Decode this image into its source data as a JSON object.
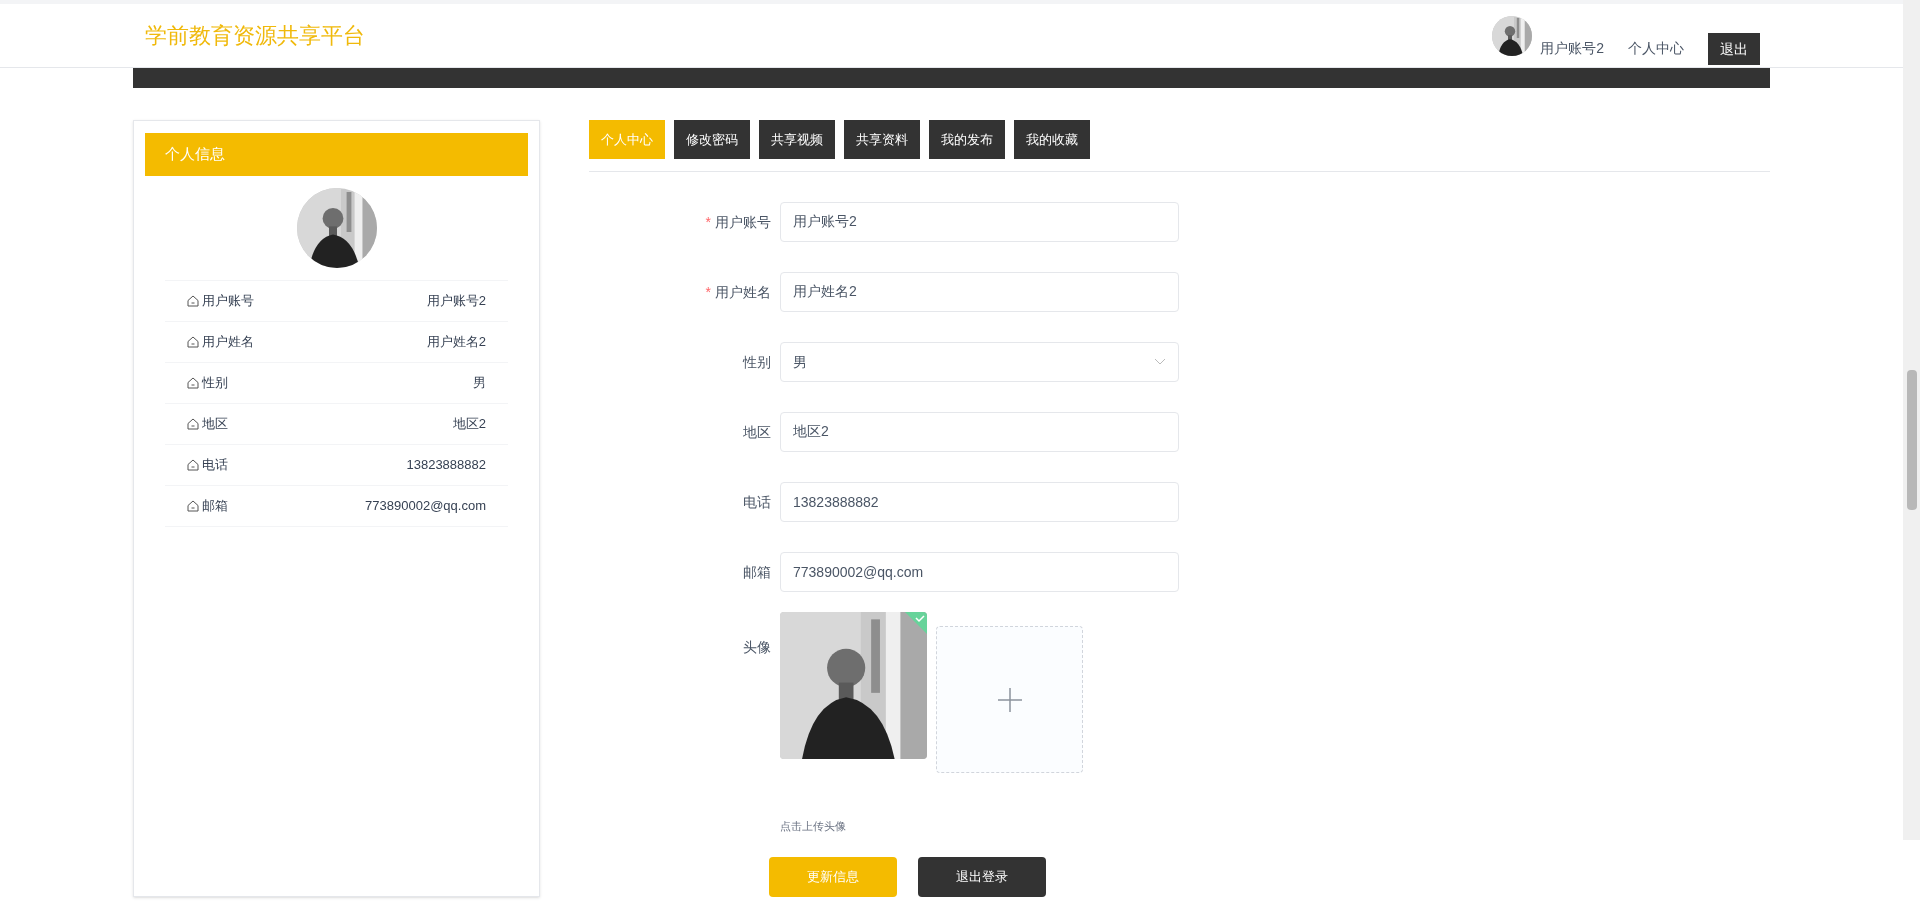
{
  "header": {
    "site_title": "学前教育资源共享平台",
    "user_name": "用户账号2",
    "nav_link": "个人中心",
    "logout_button": "退出"
  },
  "sidebar": {
    "title": "个人信息",
    "rows": [
      {
        "label": "用户账号",
        "value": "用户账号2"
      },
      {
        "label": "用户姓名",
        "value": "用户姓名2"
      },
      {
        "label": "性别",
        "value": "男"
      },
      {
        "label": "地区",
        "value": "地区2"
      },
      {
        "label": "电话",
        "value": "13823888882"
      },
      {
        "label": "邮箱",
        "value": "773890002@qq.com"
      }
    ]
  },
  "tabs": [
    {
      "label": "个人中心",
      "selected": true
    },
    {
      "label": "修改密码",
      "selected": false
    },
    {
      "label": "共享视频",
      "selected": false
    },
    {
      "label": "共享资料",
      "selected": false
    },
    {
      "label": "我的发布",
      "selected": false
    },
    {
      "label": "我的收藏",
      "selected": false
    }
  ],
  "form": {
    "fields": [
      {
        "kind": "text",
        "required_mark": "*",
        "label": "用户账号",
        "value": "用户账号2"
      },
      {
        "kind": "text",
        "required_mark": "*",
        "label": "用户姓名",
        "value": "用户姓名2"
      },
      {
        "kind": "select",
        "label": "性别",
        "value": "男"
      },
      {
        "kind": "text",
        "label": "地区",
        "value": "地区2"
      },
      {
        "kind": "text",
        "label": "电话",
        "value": "13823888882"
      },
      {
        "kind": "text",
        "label": "邮箱",
        "value": "773890002@qq.com"
      }
    ],
    "avatar": {
      "label": "头像",
      "uploaded": true,
      "hint": "点击上传头像"
    },
    "buttons": [
      {
        "kind": "primary",
        "label": "更新信息"
      },
      {
        "kind": "dark",
        "label": "退出登录"
      }
    ]
  }
}
